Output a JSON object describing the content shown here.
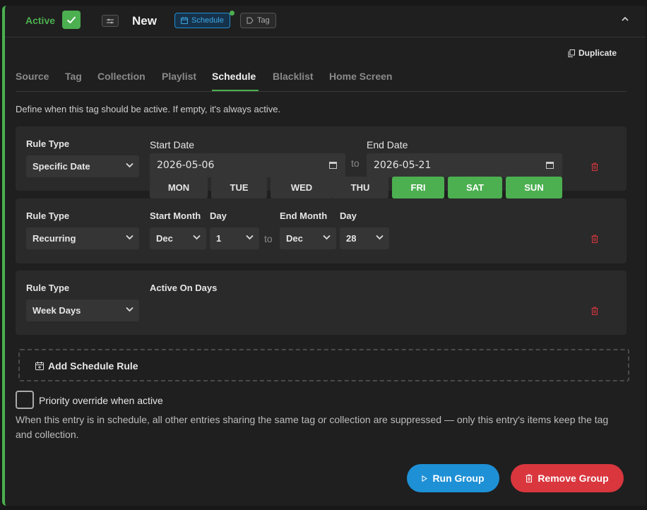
{
  "header": {
    "active_label": "Active",
    "name": "New",
    "chips": {
      "schedule": "Schedule",
      "tag": "Tag"
    }
  },
  "duplicate_label": "Duplicate",
  "tabs": [
    "Source",
    "Tag",
    "Collection",
    "Playlist",
    "Schedule",
    "Blacklist",
    "Home Screen"
  ],
  "active_tab": "Schedule",
  "description": "Define when this tag should be active. If empty, it's always active.",
  "rules": [
    {
      "type_label": "Rule Type",
      "type_value": "Specific Date",
      "start_label": "Start Date",
      "start_value": "2026-05-06",
      "to": "to",
      "end_label": "End Date",
      "end_value": "2026-05-21"
    },
    {
      "type_label": "Rule Type",
      "type_value": "Recurring",
      "start_month_label": "Start Month",
      "start_month": "Dec",
      "start_day_label": "Day",
      "start_day": "1",
      "to": "to",
      "end_month_label": "End Month",
      "end_month": "Dec",
      "end_day_label": "Day",
      "end_day": "28"
    },
    {
      "type_label": "Rule Type",
      "type_value": "Week Days",
      "days_label": "Active On Days",
      "days": [
        {
          "label": "MON",
          "active": false
        },
        {
          "label": "TUE",
          "active": false
        },
        {
          "label": "WED",
          "active": false
        },
        {
          "label": "THU",
          "active": false
        },
        {
          "label": "FRI",
          "active": true
        },
        {
          "label": "SAT",
          "active": true
        },
        {
          "label": "SUN",
          "active": true
        }
      ]
    }
  ],
  "add_rule_label": "Add Schedule Rule",
  "priority": {
    "label": "Priority override when active",
    "checked": false,
    "help": "When this entry is in schedule, all other entries sharing the same tag or collection are suppressed — only this entry's items keep the tag and collection."
  },
  "buttons": {
    "run": "Run Group",
    "remove": "Remove Group"
  },
  "colors": {
    "accent_green": "#4caf50",
    "accent_blue": "#1e90d6",
    "danger_red": "#d9363e"
  }
}
